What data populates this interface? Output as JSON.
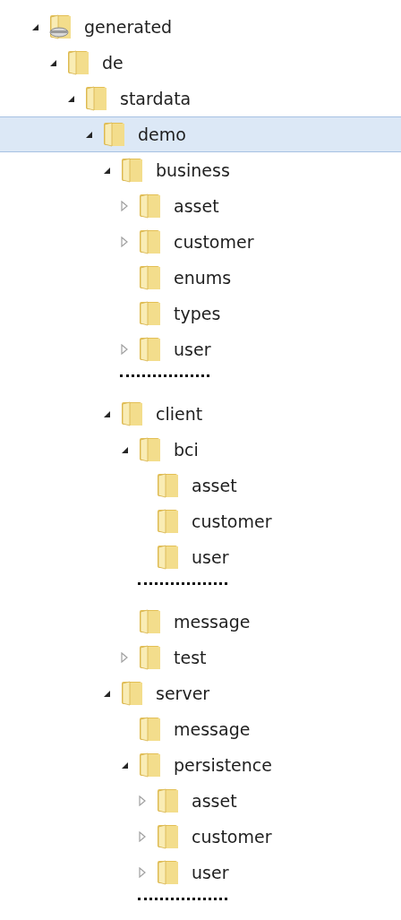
{
  "tree": [
    {
      "kind": "drive",
      "label": "generated",
      "expanded": true,
      "selected": false,
      "children": [
        {
          "kind": "folder",
          "label": "de",
          "expanded": true,
          "selected": false,
          "children": [
            {
              "kind": "folder",
              "label": "stardata",
              "expanded": true,
              "selected": false,
              "children": [
                {
                  "kind": "folder",
                  "label": "demo",
                  "expanded": true,
                  "selected": true,
                  "children": [
                    {
                      "kind": "folder",
                      "label": "business",
                      "expanded": true,
                      "selected": false,
                      "children": [
                        {
                          "kind": "folder",
                          "label": "asset",
                          "expanded": false,
                          "selected": false
                        },
                        {
                          "kind": "folder",
                          "label": "customer",
                          "expanded": false,
                          "selected": false
                        },
                        {
                          "kind": "folder",
                          "label": "enums",
                          "selected": false
                        },
                        {
                          "kind": "folder",
                          "label": "types",
                          "selected": false
                        },
                        {
                          "kind": "folder",
                          "label": "user",
                          "expanded": false,
                          "selected": false
                        },
                        {
                          "kind": "gap"
                        }
                      ]
                    },
                    {
                      "kind": "folder",
                      "label": "client",
                      "expanded": true,
                      "selected": false,
                      "children": [
                        {
                          "kind": "folder",
                          "label": "bci",
                          "expanded": true,
                          "selected": false,
                          "children": [
                            {
                              "kind": "folder",
                              "label": "asset",
                              "selected": false
                            },
                            {
                              "kind": "folder",
                              "label": "customer",
                              "selected": false
                            },
                            {
                              "kind": "folder",
                              "label": "user",
                              "selected": false
                            },
                            {
                              "kind": "gap"
                            }
                          ]
                        },
                        {
                          "kind": "folder",
                          "label": "message",
                          "selected": false
                        },
                        {
                          "kind": "folder",
                          "label": "test",
                          "expanded": false,
                          "selected": false
                        }
                      ]
                    },
                    {
                      "kind": "folder",
                      "label": "server",
                      "expanded": true,
                      "selected": false,
                      "children": [
                        {
                          "kind": "folder",
                          "label": "message",
                          "selected": false
                        },
                        {
                          "kind": "folder",
                          "label": "persistence",
                          "expanded": true,
                          "selected": false,
                          "children": [
                            {
                              "kind": "folder",
                              "label": "asset",
                              "expanded": false,
                              "selected": false
                            },
                            {
                              "kind": "folder",
                              "label": "customer",
                              "expanded": false,
                              "selected": false
                            },
                            {
                              "kind": "folder",
                              "label": "user",
                              "expanded": false,
                              "selected": false
                            },
                            {
                              "kind": "gap"
                            }
                          ]
                        }
                      ]
                    }
                  ]
                }
              ]
            }
          ]
        }
      ]
    }
  ]
}
